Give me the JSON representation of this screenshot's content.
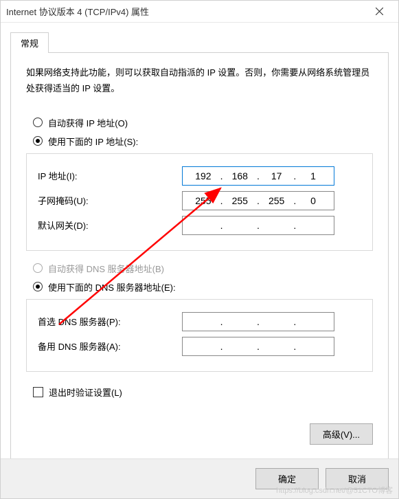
{
  "window": {
    "title": "Internet 协议版本 4 (TCP/IPv4) 属性"
  },
  "tab": {
    "general": "常规"
  },
  "description": "如果网络支持此功能，则可以获取自动指派的 IP 设置。否则，你需要从网络系统管理员处获得适当的 IP 设置。",
  "ip_section": {
    "auto_label": "自动获得 IP 地址(O)",
    "manual_label": "使用下面的 IP 地址(S):",
    "ip_label": "IP 地址(I):",
    "ip_value": {
      "o1": "192",
      "o2": "168",
      "o3": "17",
      "o4": "1"
    },
    "subnet_label": "子网掩码(U):",
    "subnet_value": {
      "o1": "255",
      "o2": "255",
      "o3": "255",
      "o4": "0"
    },
    "gateway_label": "默认网关(D):",
    "gateway_value": {
      "o1": "",
      "o2": "",
      "o3": "",
      "o4": ""
    }
  },
  "dns_section": {
    "auto_label": "自动获得 DNS 服务器地址(B)",
    "manual_label": "使用下面的 DNS 服务器地址(E):",
    "preferred_label": "首选 DNS 服务器(P):",
    "preferred_value": {
      "o1": "",
      "o2": "",
      "o3": "",
      "o4": ""
    },
    "alternate_label": "备用 DNS 服务器(A):",
    "alternate_value": {
      "o1": "",
      "o2": "",
      "o3": "",
      "o4": ""
    }
  },
  "validate_label": "退出时验证设置(L)",
  "buttons": {
    "advanced": "高级(V)...",
    "ok": "确定",
    "cancel": "取消"
  },
  "watermark": "https://blog.csdn.net/@51CTO博客"
}
